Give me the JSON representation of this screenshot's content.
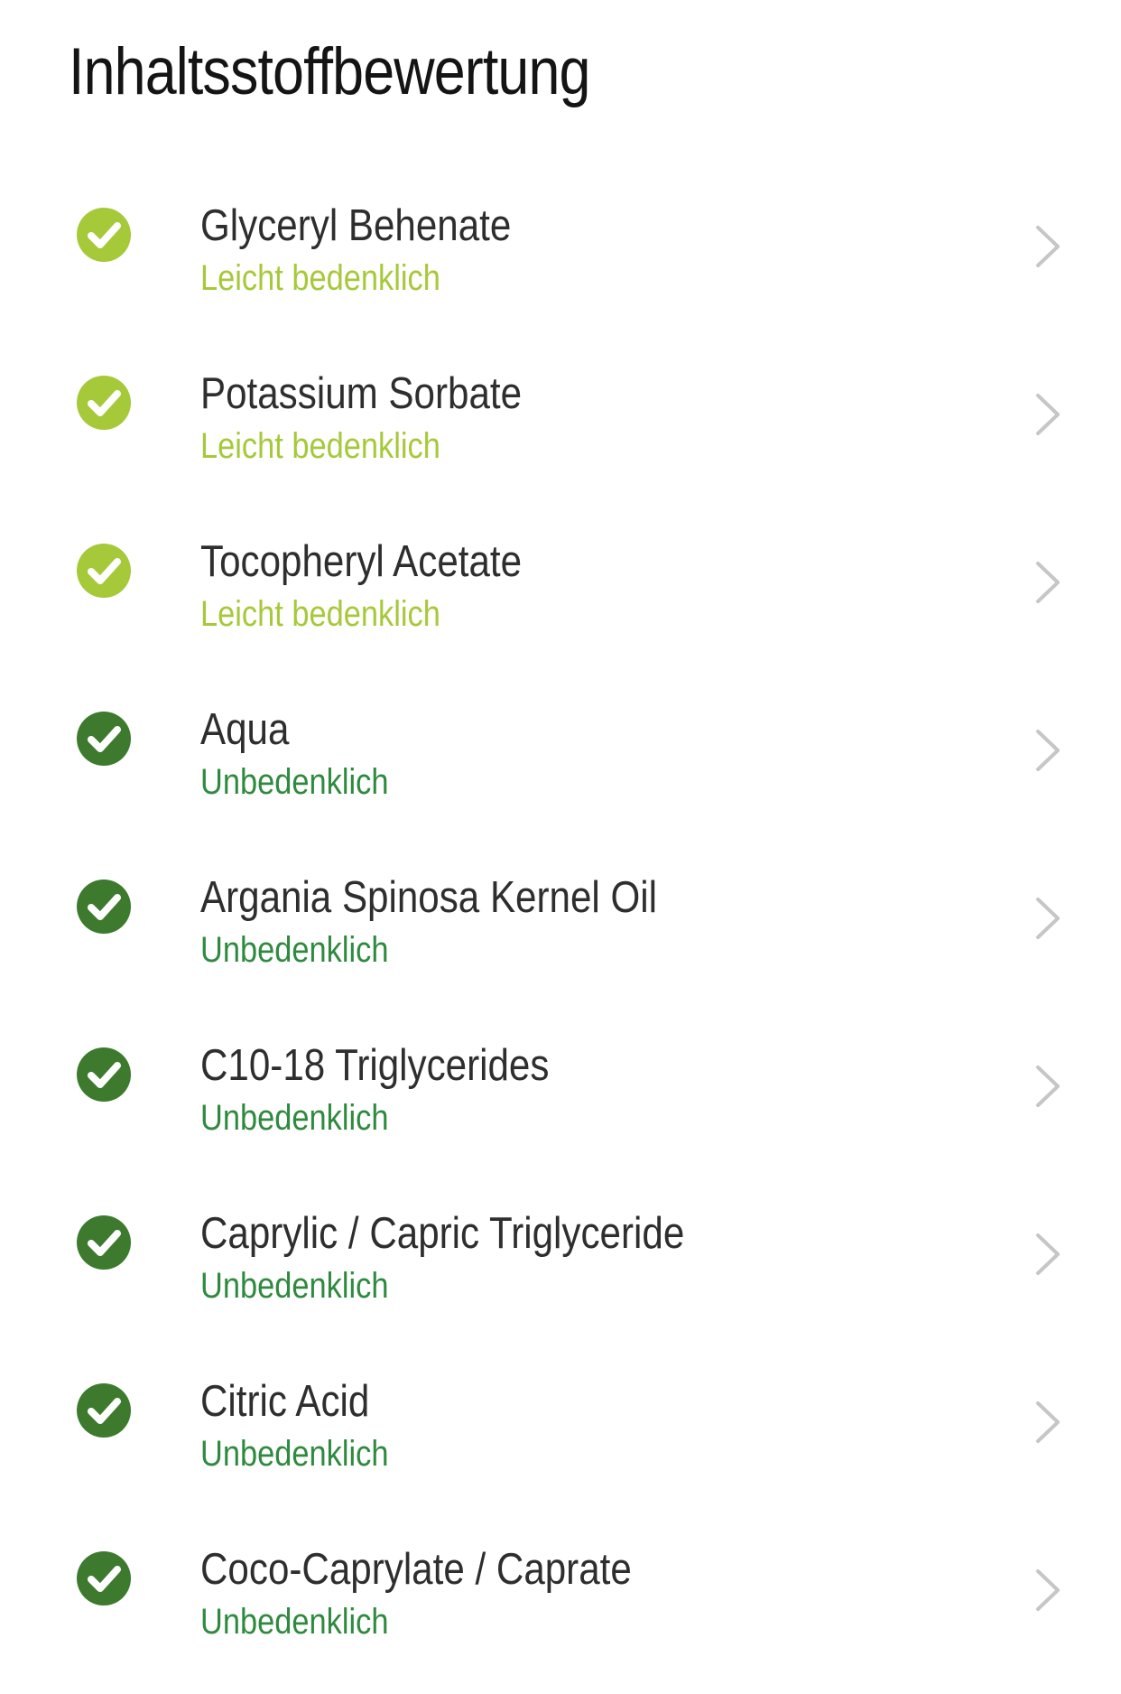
{
  "header": {
    "title": "Inhaltsstoffbewertung"
  },
  "colors": {
    "light_concern": "#a6c93a",
    "harmless": "#3d7a2e",
    "harmless_text": "#2f8a3f",
    "chevron": "#c6c6c6"
  },
  "icons": {
    "status": "check-circle-icon",
    "row_action": "chevron-right-icon"
  },
  "ingredients": [
    {
      "name": "Glyceryl Behenate",
      "rating": "Leicht bedenklich",
      "level": "light"
    },
    {
      "name": "Potassium Sorbate",
      "rating": "Leicht bedenklich",
      "level": "light"
    },
    {
      "name": "Tocopheryl Acetate",
      "rating": "Leicht bedenklich",
      "level": "light"
    },
    {
      "name": "Aqua",
      "rating": "Unbedenklich",
      "level": "safe"
    },
    {
      "name": "Argania Spinosa Kernel Oil",
      "rating": "Unbedenklich",
      "level": "safe"
    },
    {
      "name": "C10-18 Triglycerides",
      "rating": "Unbedenklich",
      "level": "safe"
    },
    {
      "name": "Caprylic / Capric Triglyceride",
      "rating": "Unbedenklich",
      "level": "safe"
    },
    {
      "name": "Citric Acid",
      "rating": "Unbedenklich",
      "level": "safe"
    },
    {
      "name": "Coco-Caprylate / Caprate",
      "rating": "Unbedenklich",
      "level": "safe"
    }
  ]
}
